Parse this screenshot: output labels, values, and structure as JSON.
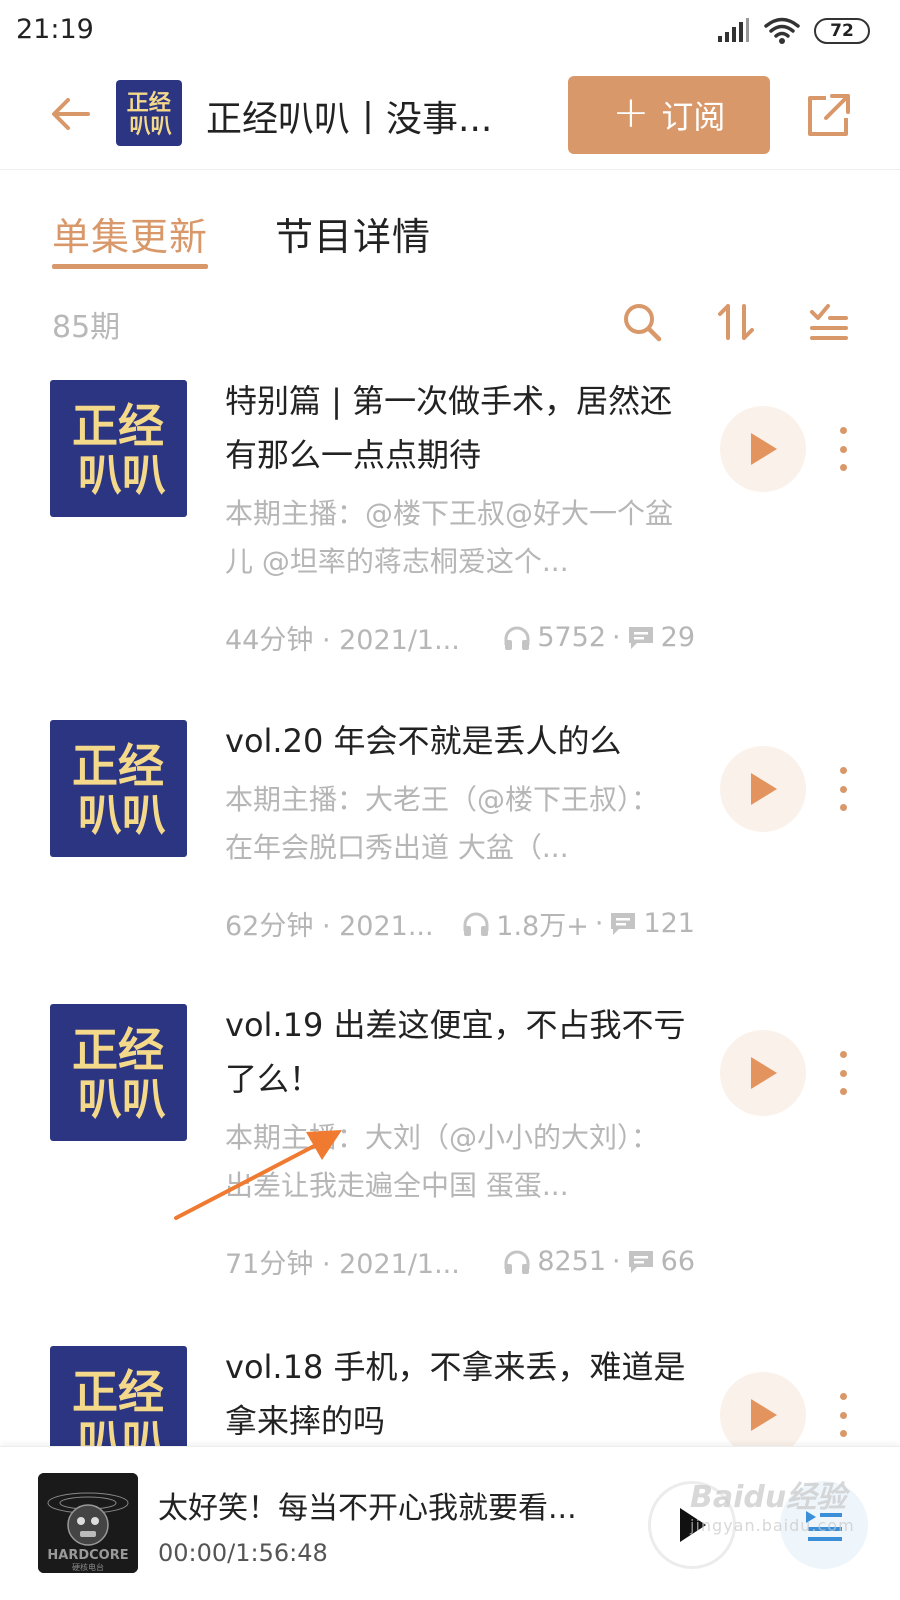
{
  "status_bar": {
    "time": "21:19",
    "battery": "72"
  },
  "header": {
    "title": "正经叭叭丨没事...",
    "subscribe_label": "订阅",
    "cover_text_top": "正经",
    "cover_text_bottom": "叭叭"
  },
  "tabs": [
    {
      "label": "单集更新",
      "active": true
    },
    {
      "label": "节目详情",
      "active": false
    }
  ],
  "toolbar": {
    "episode_count": "85期"
  },
  "episodes": [
    {
      "title": "特别篇 | 第一次做手术，居然还有那么一点点期待",
      "description": "本期主播：@楼下王叔@好大一个盆儿 @坦率的蒋志桐爱这个...",
      "duration_date": "44分钟 · 2021/1...",
      "plays": "5752",
      "comments": "29"
    },
    {
      "title": "vol.20 年会不就是丢人的么",
      "description": "本期主播：大老王（@楼下王叔）：在年会脱口秀出道 大盆（...",
      "duration_date": "62分钟 · 2021...",
      "plays": "1.8万+",
      "comments": "121"
    },
    {
      "title": "vol.19 出差这便宜，不占我不亏了么！",
      "description": "本期主播：大刘（@小小的大刘）：出差让我走遍全中国 蛋蛋...",
      "duration_date": "71分钟 · 2021/1...",
      "plays": "8251",
      "comments": "66"
    },
    {
      "title": "vol.18 手机，不拿来丢，难道是拿来摔的吗",
      "description": "",
      "duration_date": "",
      "plays": "",
      "comments": ""
    }
  ],
  "mini_player": {
    "title": "太好笑！每当不开心我就要看...",
    "time": "00:00/1:56:48",
    "cover_text": "HARDCORE",
    "cover_subtext": "硬核电台"
  },
  "watermark": {
    "brand": "Baidu经验",
    "url": "jingyan.baidu.com"
  },
  "colors": {
    "accent": "#d9986a",
    "cover_bg": "#2b3582",
    "cover_text": "#f5d98a"
  }
}
